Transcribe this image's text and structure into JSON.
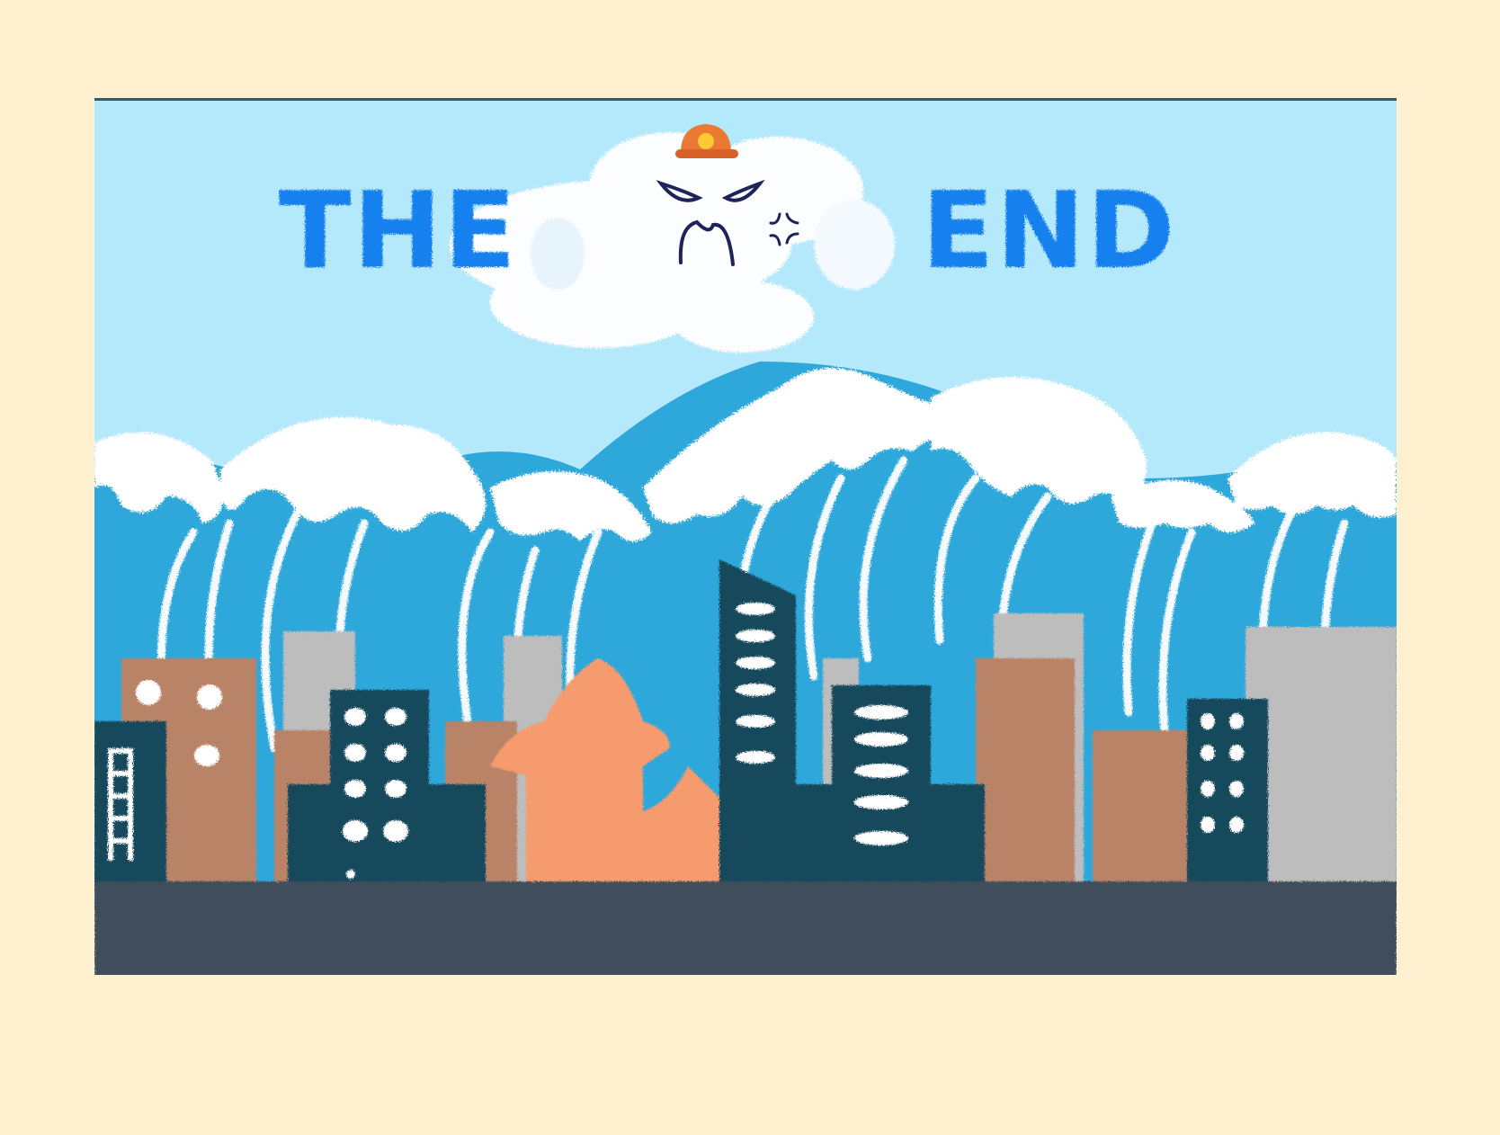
{
  "title": {
    "word_left": "THE",
    "word_right": "END"
  },
  "icons": {
    "hard_hat": "hard-hat-icon",
    "anger_mark": "anger-mark-icon"
  },
  "colors": {
    "page_background": "#fff0cf",
    "sky": "#b4e8fb",
    "wave": "#2ea7da",
    "foam": "#ffffff",
    "title_text": "#1881ee",
    "street": "#3f4e5a",
    "building_navy": "#14485c",
    "building_tan": "#b98367",
    "building_orange": "#f59b6d",
    "building_gray": "#bdbdbd",
    "hard_hat": "#e9762f"
  }
}
